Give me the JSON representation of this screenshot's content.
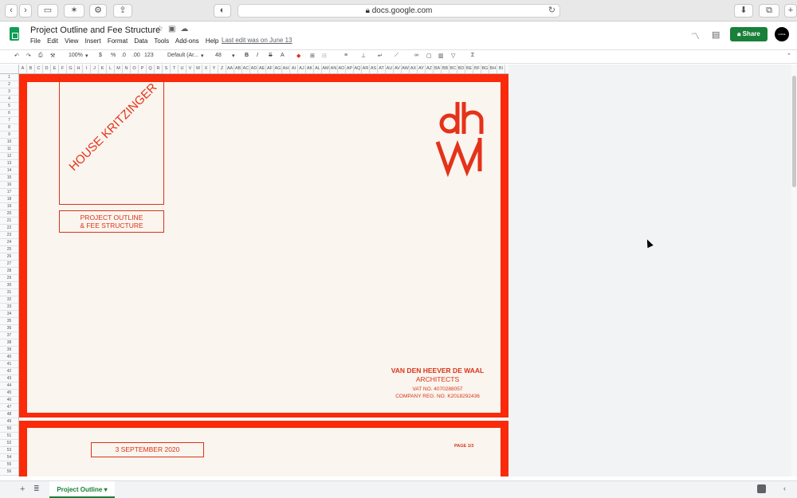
{
  "browser": {
    "url": "docs.google.com",
    "lock_icon": "lock-icon",
    "reload_icon": "reload-icon"
  },
  "header": {
    "title": "Project Outline and Fee Structure",
    "menu": [
      "File",
      "Edit",
      "View",
      "Insert",
      "Format",
      "Data",
      "Tools",
      "Add-ons",
      "Help"
    ],
    "last_edit": "Last edit was on June 13",
    "share_label": "Share",
    "avatar_text": "VOICE"
  },
  "toolbar": {
    "zoom": "100%",
    "currency": "$",
    "percent": "%",
    "dec_decrease": ".0",
    "dec_increase": ".00",
    "more_formats": "123",
    "font": "Default (Ar...",
    "font_size": "48",
    "bold": "B",
    "italic": "I",
    "strike": "S",
    "text_color": "A",
    "sigma": "Σ"
  },
  "columns": [
    "A",
    "B",
    "C",
    "D",
    "E",
    "F",
    "G",
    "H",
    "I",
    "J",
    "K",
    "L",
    "M",
    "N",
    "O",
    "P",
    "Q",
    "R",
    "S",
    "T",
    "U",
    "V",
    "W",
    "X",
    "Y",
    "Z",
    "AA",
    "AB",
    "AC",
    "AD",
    "AE",
    "AF",
    "AG",
    "AH",
    "AI",
    "AJ",
    "AK",
    "AL",
    "AM",
    "AN",
    "AO",
    "AP",
    "AQ",
    "AR",
    "AS",
    "AT",
    "AU",
    "AV",
    "AW",
    "AX",
    "AY",
    "AZ",
    "BA",
    "BB",
    "BC",
    "BD",
    "BE",
    "BF",
    "BG",
    "BH",
    "BI"
  ],
  "document": {
    "project_name": "HOUSE KRITZINGER",
    "outline_line1": "PROJECT OUTLINE",
    "outline_line2": "& FEE STRUCTURE",
    "firm_name": "VAN DEN HEEVER DE WAAL",
    "firm_sub": "ARCHITECTS",
    "vat": "VAT NO.  4070288057",
    "company_reg": "COMPANY REG. NO. K2018292436",
    "date": "3 SEPTEMBER 2020",
    "page": "PAGE 1/3",
    "accent": "#fa2a0a",
    "paper": "#faf5ee"
  },
  "tabs": {
    "active": "Project Outline"
  }
}
